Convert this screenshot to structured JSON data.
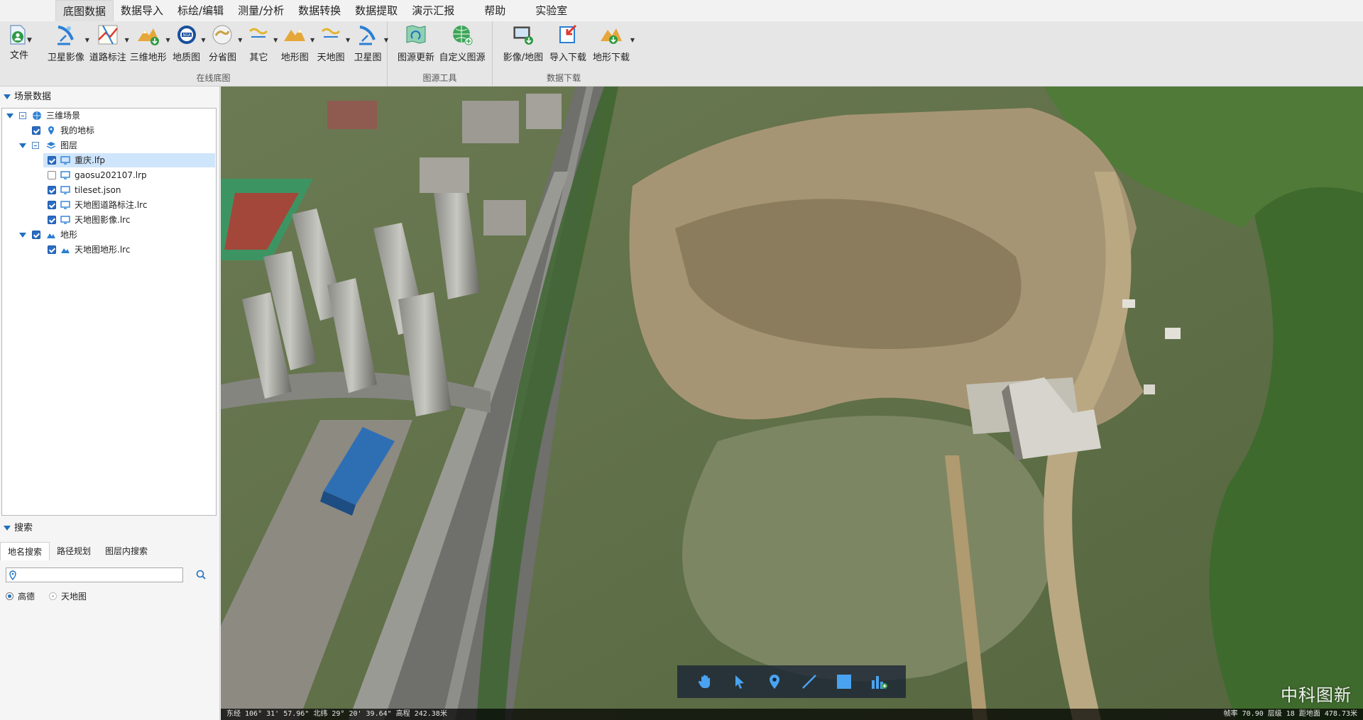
{
  "menu": {
    "tabs": [
      "底图数据",
      "数据导入",
      "标绘/编辑",
      "测量/分析",
      "数据转换",
      "数据提取",
      "演示汇报",
      "帮助",
      "实验室"
    ],
    "active_index": 0
  },
  "ribbon": {
    "file_label": "文件",
    "groups": [
      {
        "title": "在线底图",
        "buttons": [
          "卫星影像",
          "道路标注",
          "三维地形",
          "地质图",
          "分省图",
          "其它",
          "地形图",
          "天地图",
          "卫星图"
        ]
      },
      {
        "title": "图源工具",
        "buttons": [
          "图源更新",
          "自定义图源"
        ]
      },
      {
        "title": "数据下载",
        "buttons": [
          "影像/地图",
          "导入下载",
          "地形下载"
        ]
      }
    ]
  },
  "scene_panel": {
    "title": "场景数据",
    "tree": {
      "root": "三维场景",
      "my_marks": "我的地标",
      "layers_folder": "图层",
      "layers": [
        {
          "name": "重庆.lfp",
          "checked": true,
          "selected": true
        },
        {
          "name": "gaosu202107.lrp",
          "checked": false,
          "selected": false
        },
        {
          "name": "tileset.json",
          "checked": true,
          "selected": false
        },
        {
          "name": "天地图道路标注.lrc",
          "checked": true,
          "selected": false
        },
        {
          "name": "天地图影像.lrc",
          "checked": true,
          "selected": false
        }
      ],
      "terrain_folder": "地形",
      "terrain": [
        {
          "name": "天地图地形.lrc",
          "checked": true
        }
      ]
    }
  },
  "search_panel": {
    "title": "搜索",
    "tabs": [
      "地名搜索",
      "路径规划",
      "图层内搜索"
    ],
    "active_tab": 0,
    "input_value": "",
    "providers": [
      {
        "label": "高德",
        "selected": true
      },
      {
        "label": "天地图",
        "selected": false
      }
    ]
  },
  "map": {
    "toolbar_tools": [
      "pan-hand-icon",
      "select-arrow-icon",
      "placemark-pin-icon",
      "line-draw-icon",
      "rectangle-draw-icon",
      "chart-analysis-icon"
    ],
    "watermark": "中科图新",
    "status_left": "东经 106° 31' 57.96\"  北纬 29° 20' 39.64\"  高程 242.38米",
    "status_right": "帧率 70.90  层级 18  距地面 478.73米"
  }
}
